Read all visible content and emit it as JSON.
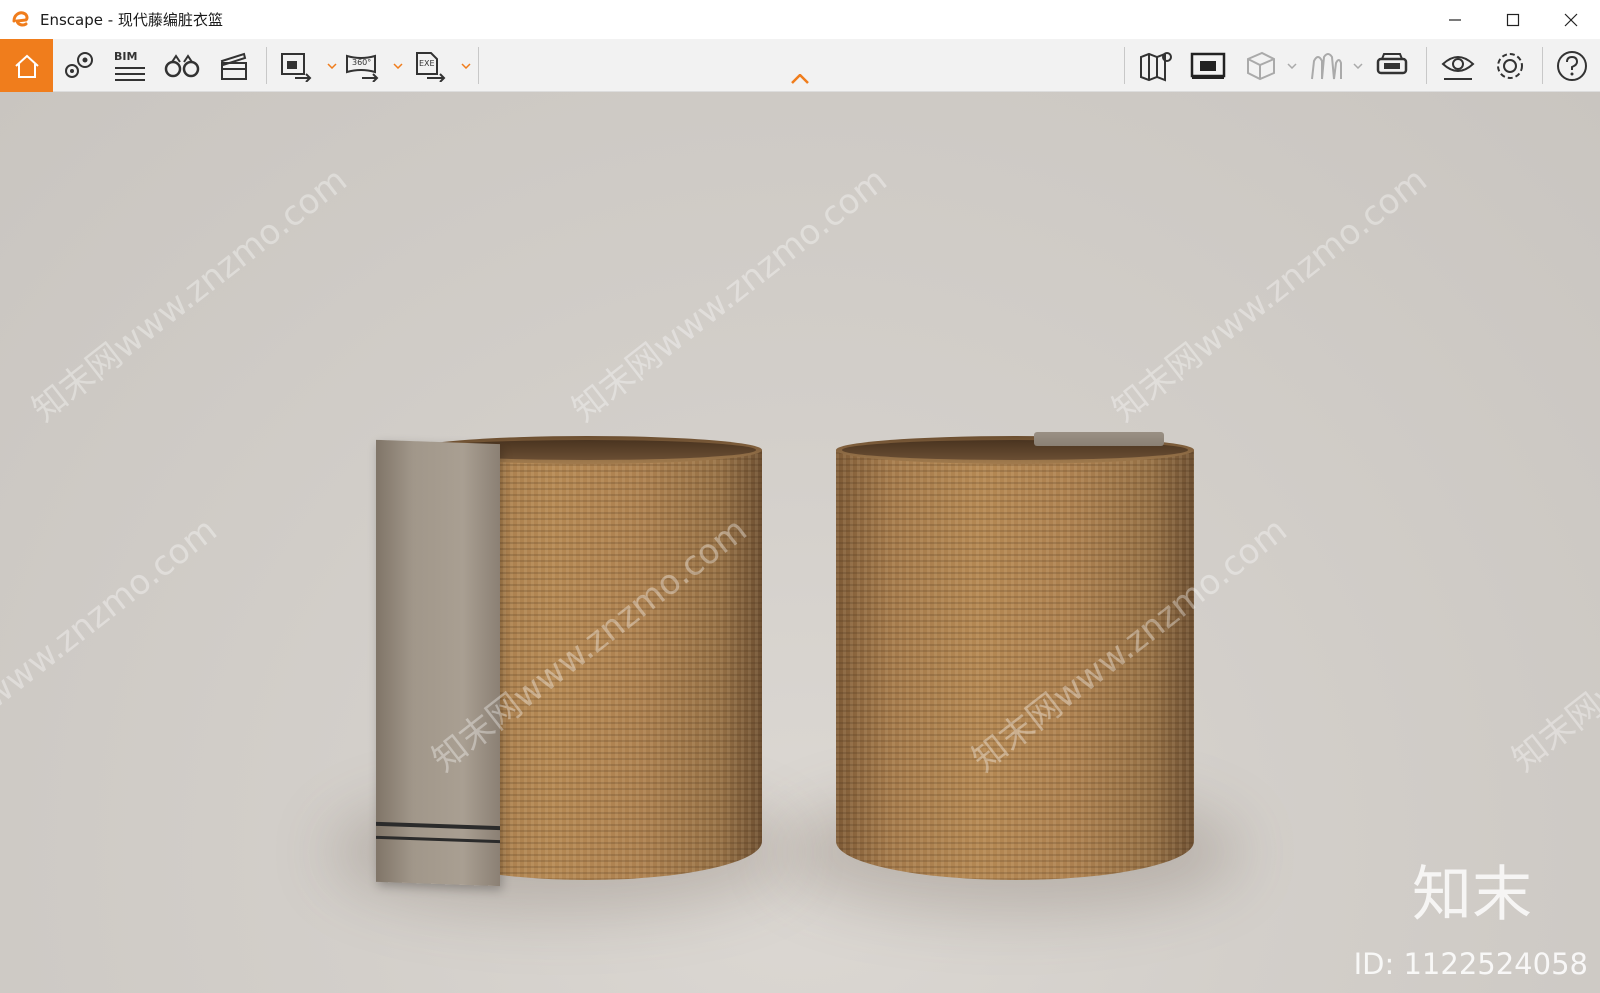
{
  "window": {
    "title": "Enscape - 现代藤编脏衣篮",
    "controls": [
      "minimize-icon",
      "maximize-icon",
      "close-icon"
    ]
  },
  "toolbar": {
    "bim_label": "BIM",
    "left_tools": [
      "home-icon",
      "map-pin-icon",
      "bim-icon",
      "binoculars-icon",
      "clapper-icon",
      "export-image-icon",
      "export-360-icon",
      "export-exe-icon"
    ],
    "right_tools": [
      "map-icon",
      "monitor-icon",
      "cube-icon",
      "asset-icon",
      "vr-headset-icon",
      "eye-icon",
      "settings-icon",
      "help-icon"
    ],
    "export_360_label": "360°",
    "export_exe_label": "EXE",
    "accent": "#f07d1c"
  },
  "viewport": {
    "watermark_text": "知末网www.znzmo.com",
    "brand": "知末",
    "id_text": "ID: 1122524058"
  }
}
